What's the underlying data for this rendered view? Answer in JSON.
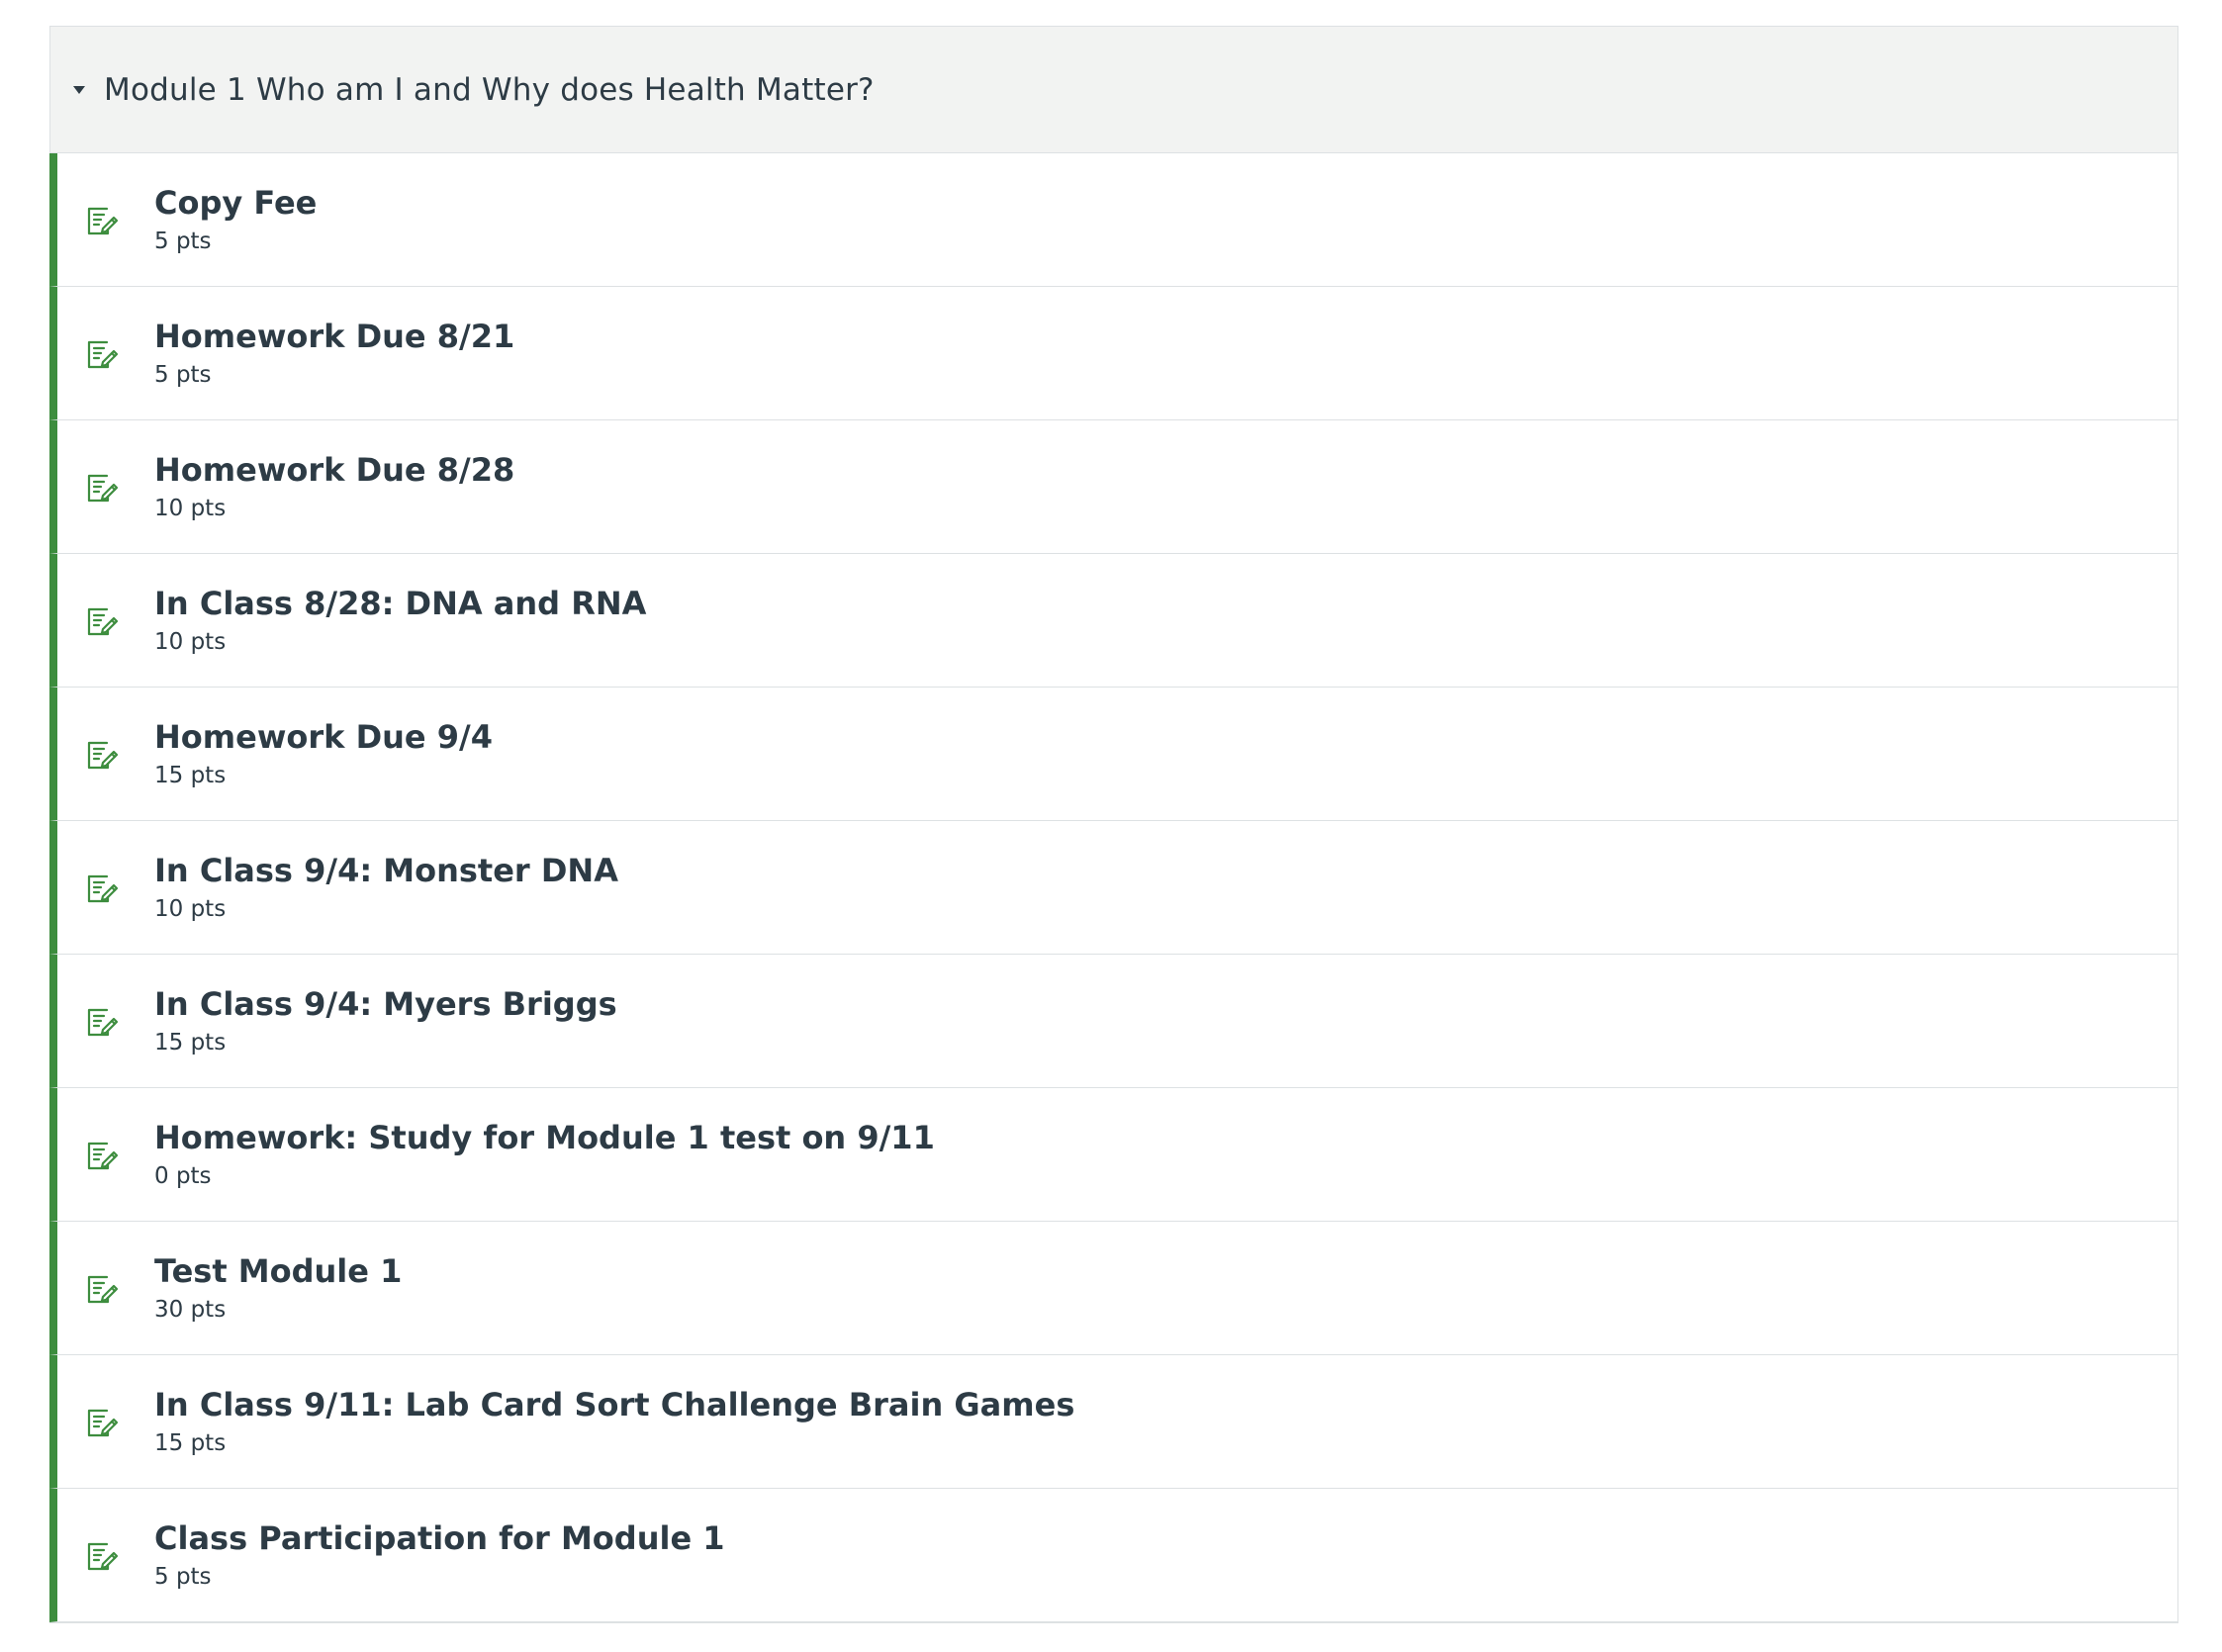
{
  "colors": {
    "accent_border": "#3d8d3e",
    "icon_green": "#3d8d3e",
    "header_bg": "#f2f3f2",
    "text": "#2d3b45"
  },
  "module": {
    "title": "Module 1 Who am I and Why does Health Matter?",
    "collapse_icon": "triangle-down-icon",
    "items": [
      {
        "title": "Copy Fee",
        "points": "5 pts",
        "icon": "assignment-icon"
      },
      {
        "title": "Homework Due 8/21",
        "points": "5 pts",
        "icon": "assignment-icon"
      },
      {
        "title": "Homework Due 8/28",
        "points": "10 pts",
        "icon": "assignment-icon"
      },
      {
        "title": "In Class 8/28: DNA and RNA",
        "points": "10 pts",
        "icon": "assignment-icon"
      },
      {
        "title": "Homework Due 9/4",
        "points": "15 pts",
        "icon": "assignment-icon"
      },
      {
        "title": "In Class 9/4: Monster DNA",
        "points": "10 pts",
        "icon": "assignment-icon"
      },
      {
        "title": "In Class 9/4: Myers Briggs",
        "points": "15 pts",
        "icon": "assignment-icon"
      },
      {
        "title": "Homework: Study for Module 1 test on 9/11",
        "points": "0 pts",
        "icon": "assignment-icon"
      },
      {
        "title": "Test Module 1",
        "points": "30 pts",
        "icon": "assignment-icon"
      },
      {
        "title": "In Class 9/11: Lab Card Sort Challenge Brain Games",
        "points": "15 pts",
        "icon": "assignment-icon"
      },
      {
        "title": "Class Participation for Module 1",
        "points": "5 pts",
        "icon": "assignment-icon"
      }
    ]
  }
}
